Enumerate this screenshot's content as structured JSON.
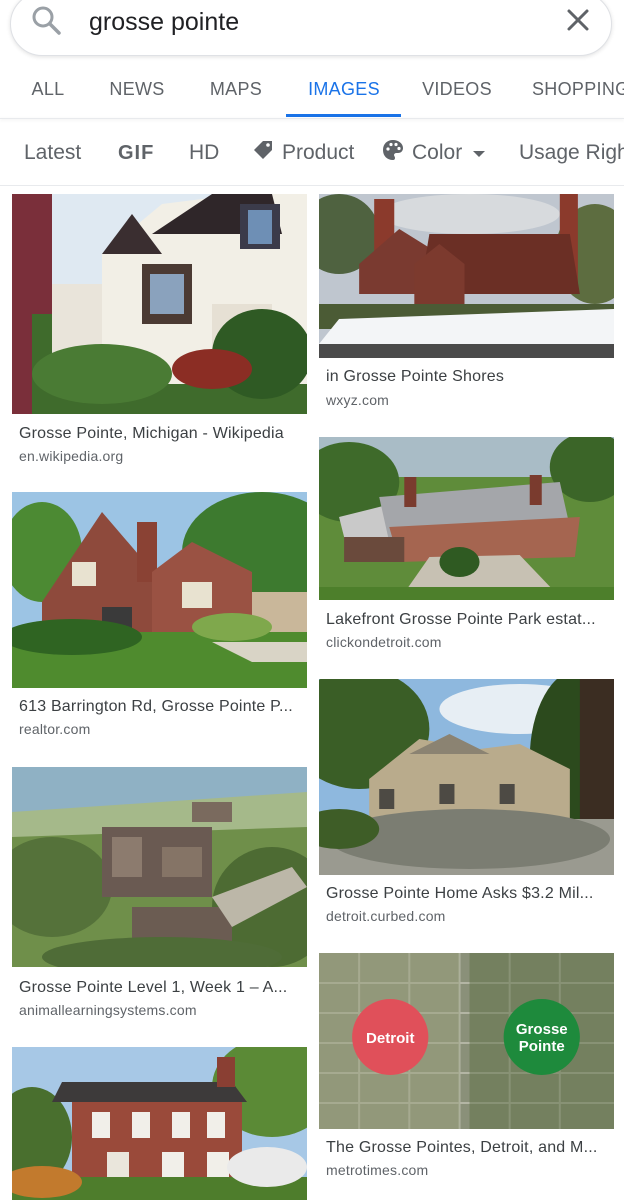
{
  "search": {
    "query": "grosse pointe",
    "search_icon": "search-icon",
    "clear_icon": "close-icon"
  },
  "tabs": [
    {
      "label": "ALL"
    },
    {
      "label": "NEWS"
    },
    {
      "label": "MAPS"
    },
    {
      "label": "IMAGES",
      "active": true
    },
    {
      "label": "VIDEOS"
    },
    {
      "label": "SHOPPING"
    }
  ],
  "filters": [
    {
      "label": "Latest"
    },
    {
      "label": "GIF",
      "icon": "gif-icon"
    },
    {
      "label": "HD"
    },
    {
      "label": "Product",
      "icon": "tag-icon"
    },
    {
      "label": "Color",
      "icon": "palette-icon"
    },
    {
      "label": "Usage Rights"
    }
  ],
  "results": {
    "left": [
      {
        "caption": "Grosse Pointe, Michigan - Wikipedia",
        "source": "en.wikipedia.org"
      },
      {
        "caption": "613 Barrington Rd, Grosse Pointe P...",
        "source": "realtor.com"
      },
      {
        "caption": "Grosse Pointe Level 1, Week 1 – A...",
        "source": "animallearningsystems.com"
      },
      {
        "caption": "",
        "source": ""
      }
    ],
    "right": [
      {
        "caption": "in Grosse Pointe Shores",
        "source": "wxyz.com"
      },
      {
        "caption": "Lakefront Grosse Pointe Park estat...",
        "source": "clickondetroit.com"
      },
      {
        "caption": "Grosse Pointe Home Asks $3.2 Mil...",
        "source": "detroit.curbed.com"
      },
      {
        "caption": "The Grosse Pointes, Detroit, and M...",
        "source": "metrotimes.com",
        "map_labels": {
          "left": "Detroit",
          "right_line1": "Grosse",
          "right_line2": "Pointe"
        }
      }
    ]
  },
  "colors": {
    "accent": "#1a73e8",
    "detroit_circle": "#e0505a",
    "grosse_pointe_circle": "#1e8a3c"
  }
}
